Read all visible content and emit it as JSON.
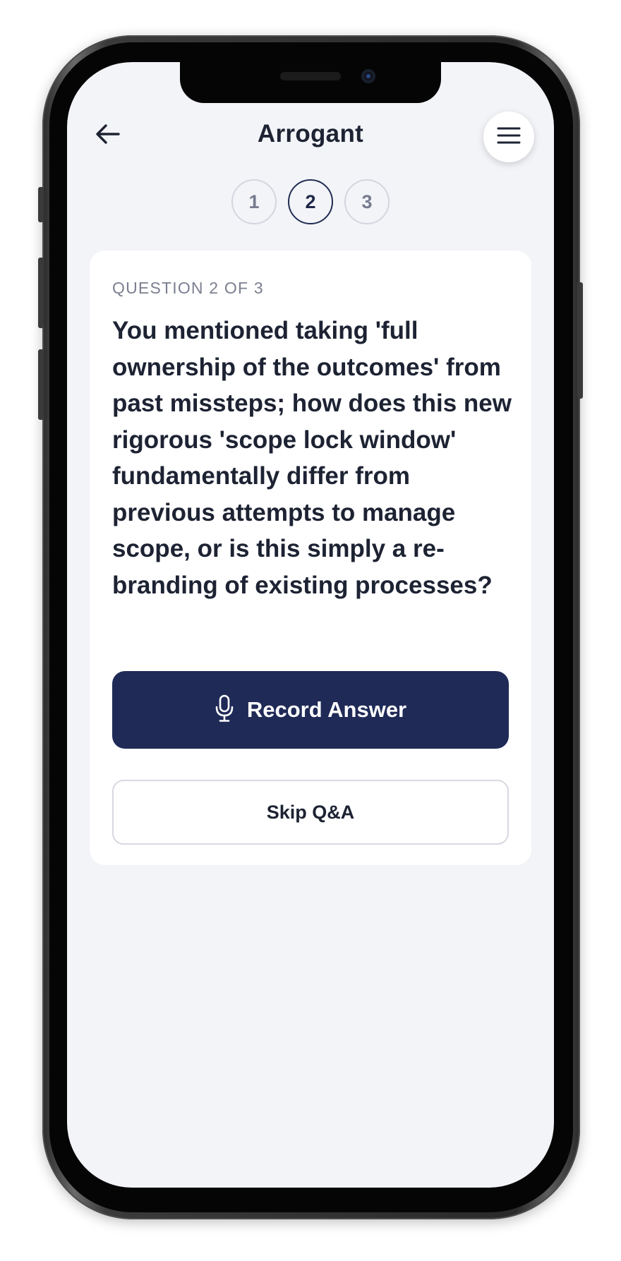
{
  "header": {
    "title": "Arrogant",
    "back_icon": "arrow-left-icon",
    "menu_icon": "hamburger-menu-icon"
  },
  "steps": [
    {
      "label": "1",
      "active": false
    },
    {
      "label": "2",
      "active": true
    },
    {
      "label": "3",
      "active": false
    }
  ],
  "question": {
    "counter_label": "QUESTION 2 OF 3",
    "text": "You mentioned taking 'full ownership of the outcomes' from past missteps; how does this new rigorous 'scope lock window' fundamentally differ from previous attempts to manage scope, or is this simply a re-branding of existing processes?"
  },
  "actions": {
    "record_label": "Record Answer",
    "record_icon": "microphone-icon",
    "skip_label": "Skip Q&A"
  },
  "colors": {
    "primary": "#1f2a57",
    "screen_background": "#f3f4f8",
    "card_background": "#ffffff",
    "text": "#1d2333",
    "muted_text": "#7b7f90"
  }
}
